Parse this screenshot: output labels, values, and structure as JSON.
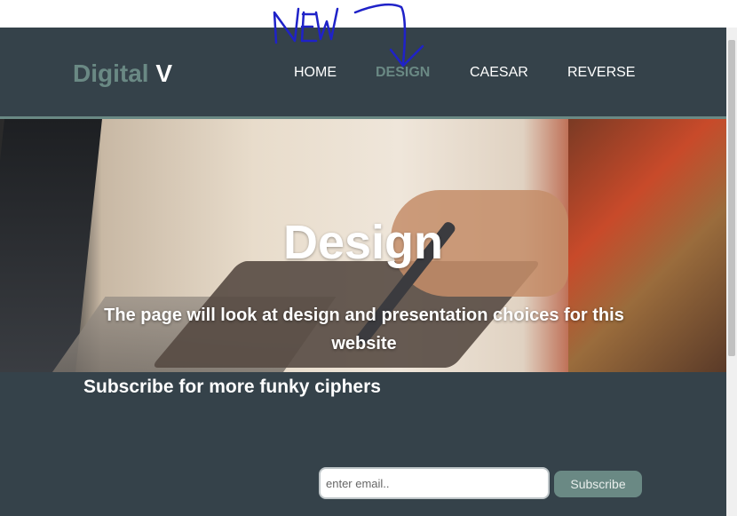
{
  "site": {
    "logo_main": "Digital",
    "logo_accent": "V"
  },
  "nav": [
    {
      "label": "HOME",
      "active": false
    },
    {
      "label": "DESIGN",
      "active": true
    },
    {
      "label": "CAESAR",
      "active": false
    },
    {
      "label": "REVERSE",
      "active": false
    }
  ],
  "hero": {
    "title": "Design",
    "subtitle": "The page will look at design and presentation choices for this website"
  },
  "subscribe": {
    "heading": "Subscribe for more funky ciphers",
    "email_placeholder": "enter email..",
    "button_label": "Subscribe"
  },
  "annotation": {
    "handwritten_text": "NEW"
  },
  "colors": {
    "header_bg": "#35424a",
    "accent": "#6a8984",
    "annotation_ink": "#1f22c8"
  }
}
